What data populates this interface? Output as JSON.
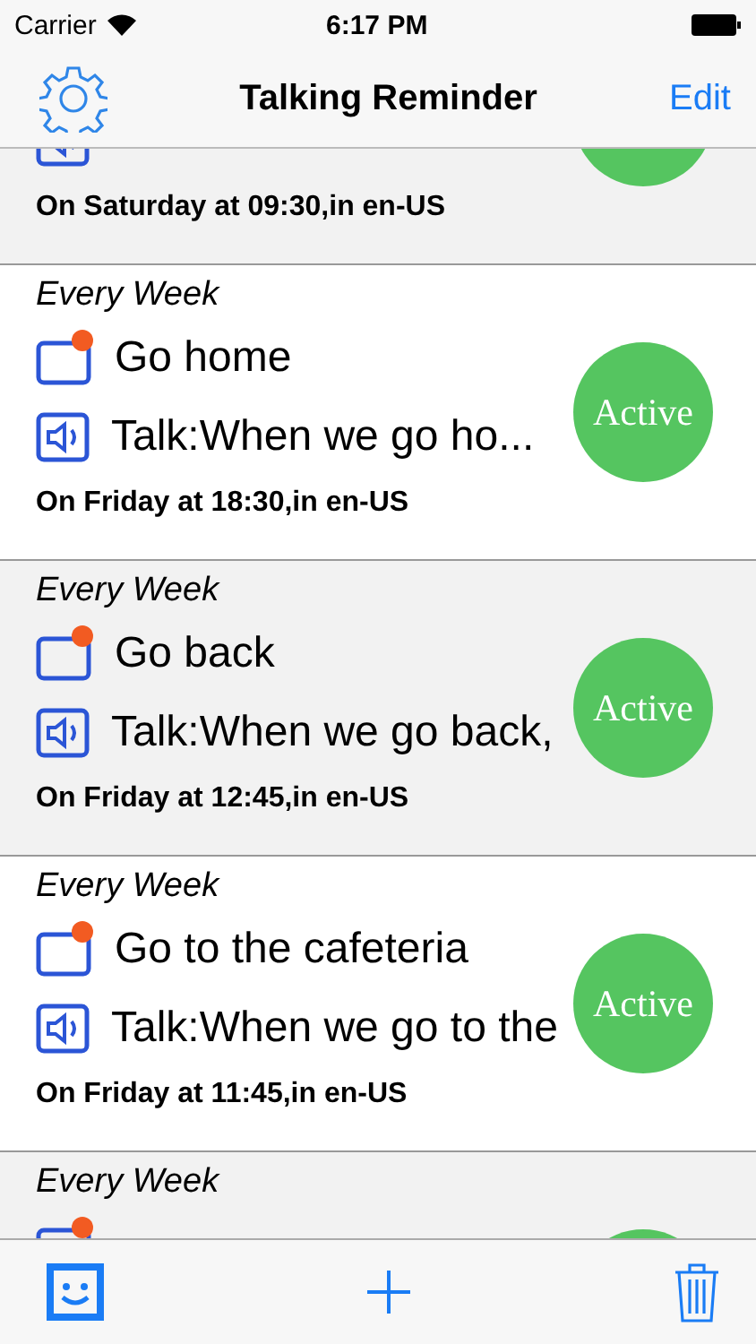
{
  "status_bar": {
    "carrier": "Carrier",
    "time": "6:17 PM"
  },
  "nav": {
    "title": "Talking Reminder",
    "edit": "Edit"
  },
  "reminders": [
    {
      "schedule": "On Saturday at 09:30,in en-US"
    },
    {
      "repeat": "Every Week",
      "title": "Go home",
      "talk": "Talk:When we go ho...",
      "schedule": "On Friday at 18:30,in en-US",
      "status": "Active"
    },
    {
      "repeat": "Every Week",
      "title": "Go back",
      "talk": "Talk:When we go back,",
      "schedule": "On Friday at 12:45,in en-US",
      "status": "Active"
    },
    {
      "repeat": "Every Week",
      "title": "Go to the cafeteria",
      "talk": "Talk:When we go to the",
      "schedule": "On Friday at 11:45,in en-US",
      "status": "Active"
    },
    {
      "repeat": "Every Week"
    }
  ]
}
